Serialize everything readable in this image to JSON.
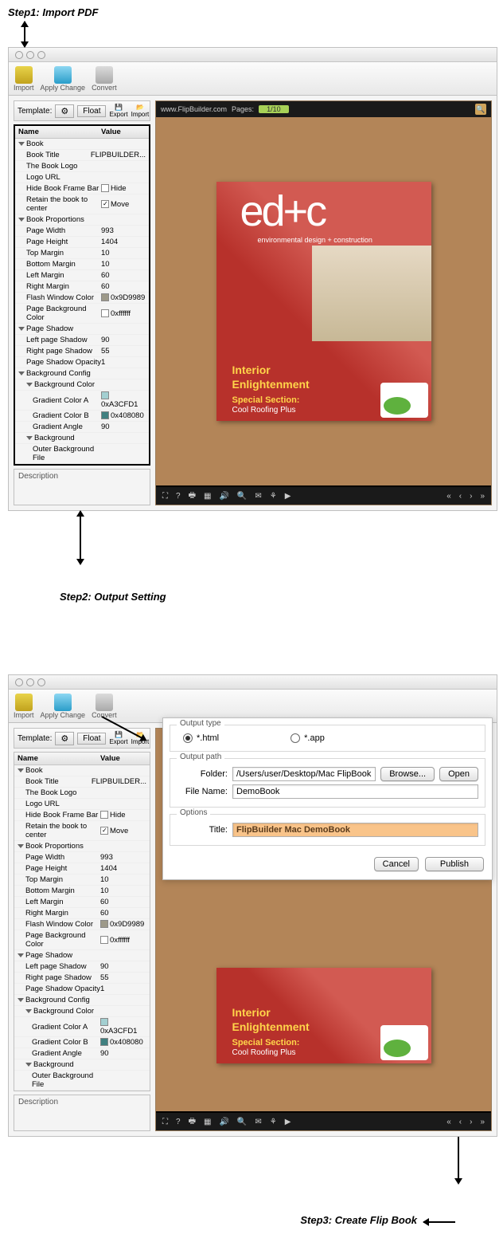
{
  "steps": {
    "s1": "Step1: Import PDF",
    "s2": "Step2: Output Setting",
    "s3": "Step3: Create Flip Book"
  },
  "toolbar": {
    "import": "Import",
    "apply": "Apply Change",
    "convert": "Convert"
  },
  "template": {
    "label": "Template:",
    "float": "Float",
    "export": "Export",
    "import": "Import"
  },
  "propsHeader": {
    "name": "Name",
    "value": "Value"
  },
  "props": [
    {
      "n": "Book",
      "v": "",
      "grp": 1,
      "i": 0
    },
    {
      "n": "Book Title",
      "v": "FLIPBUILDER...",
      "i": 1
    },
    {
      "n": "The Book Logo",
      "v": "",
      "i": 1
    },
    {
      "n": "Logo URL",
      "v": "",
      "i": 1
    },
    {
      "n": "Hide Book Frame Bar",
      "v": "Hide",
      "chk": 0,
      "i": 1
    },
    {
      "n": "Retain the book to center",
      "v": "Move",
      "chk": 1,
      "i": 1
    },
    {
      "n": "Book Proportions",
      "v": "",
      "grp": 1,
      "i": 0
    },
    {
      "n": "Page Width",
      "v": "993",
      "i": 1
    },
    {
      "n": "Page Height",
      "v": "1404",
      "i": 1
    },
    {
      "n": "Top Margin",
      "v": "10",
      "i": 1
    },
    {
      "n": "Bottom Margin",
      "v": "10",
      "i": 1
    },
    {
      "n": "Left Margin",
      "v": "60",
      "i": 1
    },
    {
      "n": "Right Margin",
      "v": "60",
      "i": 1
    },
    {
      "n": "Flash Window Color",
      "v": "0x9D9989",
      "sw": "#9D9989",
      "i": 1
    },
    {
      "n": "Page Background Color",
      "v": "0xffffff",
      "sw": "#ffffff",
      "i": 1
    },
    {
      "n": "Page Shadow",
      "v": "",
      "grp": 1,
      "i": 0
    },
    {
      "n": "Left page Shadow",
      "v": "90",
      "i": 1
    },
    {
      "n": "Right page Shadow",
      "v": "55",
      "i": 1
    },
    {
      "n": "Page Shadow Opacity",
      "v": "1",
      "i": 1
    },
    {
      "n": "Background Config",
      "v": "",
      "grp": 1,
      "i": 0
    },
    {
      "n": "Background Color",
      "v": "",
      "grp": 1,
      "i": 1
    },
    {
      "n": "Gradient Color A",
      "v": "0xA3CFD1",
      "sw": "#A3CFD1",
      "i": 2
    },
    {
      "n": "Gradient Color B",
      "v": "0x408080",
      "sw": "#408080",
      "i": 2
    },
    {
      "n": "Gradient Angle",
      "v": "90",
      "i": 2
    },
    {
      "n": "Background",
      "v": "",
      "grp": 1,
      "i": 1
    },
    {
      "n": "Outer Background File",
      "v": "",
      "i": 2
    }
  ],
  "description": "Description",
  "preview": {
    "url": "www.FlipBuilder.com",
    "pagesLabel": "Pages:",
    "pageIndicator": "1/10",
    "mag": {
      "title": "ed+c",
      "sub": "environmental design + construction",
      "t1": "Interior",
      "t1b": "Enlightenment",
      "t2": "Special Section:",
      "t3": "Cool Roofing Plus"
    }
  },
  "dialog": {
    "outputTypeLabel": "Output type",
    "html": "*.html",
    "app": "*.app",
    "outputPathLabel": "Output path",
    "folderLabel": "Folder:",
    "folderValue": "/Users/user/Desktop/Mac FlipBook",
    "browse": "Browse...",
    "open": "Open",
    "fileNameLabel": "File Name:",
    "fileNameValue": "DemoBook",
    "optionsLabel": "Options",
    "titleLabel": "Title:",
    "titleValue": "FlipBuilder Mac DemoBook",
    "cancel": "Cancel",
    "publish": "Publish"
  }
}
